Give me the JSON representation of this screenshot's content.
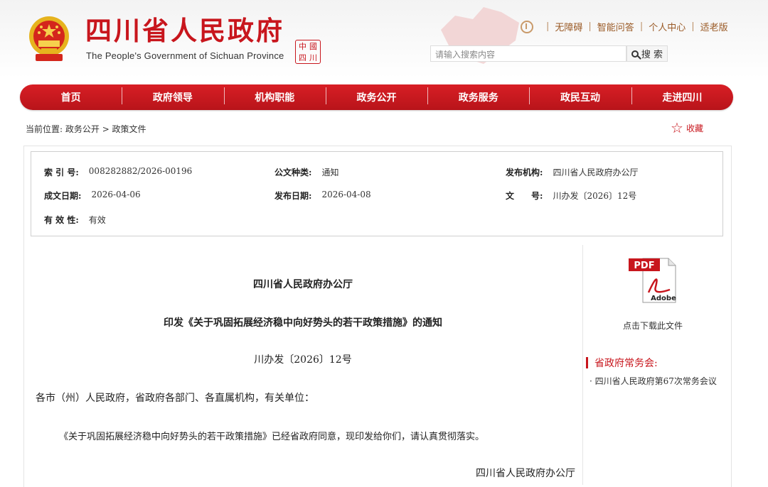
{
  "header": {
    "site_title": "四川省人民政府",
    "site_subtitle": "The People's Government of Sichuan Province",
    "seal_chars": [
      "中",
      "國",
      "四",
      "川"
    ],
    "top_links": [
      "无障碍",
      "智能问答",
      "个人中心",
      "适老版"
    ],
    "search_placeholder": "请输入搜索内容",
    "search_button": "搜 索"
  },
  "nav": {
    "items": [
      "首页",
      "政府领导",
      "机构职能",
      "政务公开",
      "政务服务",
      "政民互动",
      "走进四川"
    ]
  },
  "breadcrumb": {
    "label": "当前位置:",
    "path": "政务公开 > 政策文件"
  },
  "favorite_label": "收藏",
  "meta": {
    "index_no_label": "索 引 号:",
    "index_no": "008282882/2026-00196",
    "doc_type_label": "公文种类:",
    "doc_type": "通知",
    "publisher_label": "发布机构:",
    "publisher": "四川省人民政府办公厅",
    "created_label": "成文日期:",
    "created": "2026-04-06",
    "published_label": "发布日期:",
    "published": "2026-04-08",
    "doc_no_label": "文　　号:",
    "doc_no": "川办发〔2026〕12号",
    "validity_label": "有 效 性:",
    "validity": "有效"
  },
  "document": {
    "issuer": "四川省人民政府办公厅",
    "title": "印发《关于巩固拓展经济稳中向好势头的若干政策措施》的通知",
    "number": "川办发〔2026〕12号",
    "addressee": "各市（州）人民政府，省政府各部门、各直属机构，有关单位：",
    "body": "《关于巩固拓展经济稳中向好势头的若干政策措施》已经省政府同意，现印发给你们，请认真贯彻落实。",
    "signature": "四川省人民政府办公厅"
  },
  "sidebar": {
    "pdf_label": "PDF",
    "adobe_label": "Adobe",
    "download_caption": "点击下载此文件",
    "section_title": "省政府常务会:",
    "items": [
      "· 四川省人民政府第67次常务会议"
    ]
  },
  "colors": {
    "brand_red": "#c8161d",
    "link_brown": "#9a5a26"
  }
}
